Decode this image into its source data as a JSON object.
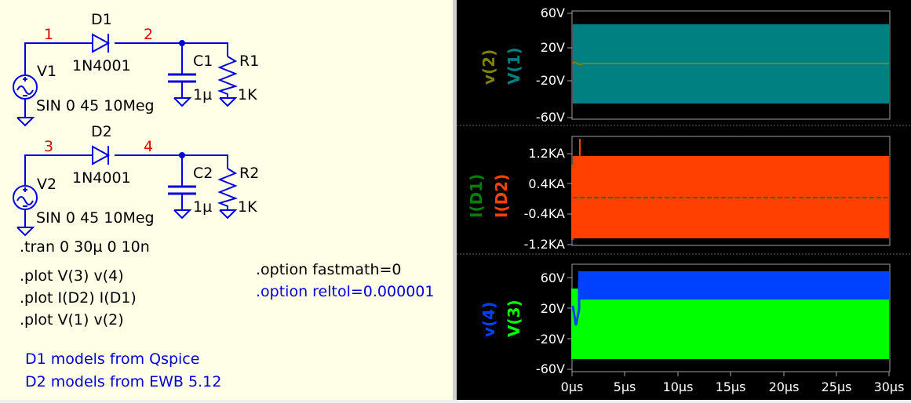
{
  "schematic": {
    "nodes": [
      "1",
      "2",
      "3",
      "4"
    ],
    "diodes": [
      {
        "ref": "D1",
        "model": "1N4001"
      },
      {
        "ref": "D2",
        "model": "1N4001"
      }
    ],
    "sources": [
      {
        "ref": "V1",
        "value": "SIN 0 45 10Meg"
      },
      {
        "ref": "V2",
        "value": "SIN 0 45 10Meg"
      }
    ],
    "capacitors": [
      {
        "ref": "C1",
        "value": "1µ"
      },
      {
        "ref": "C2",
        "value": "1µ"
      }
    ],
    "resistors": [
      {
        "ref": "R1",
        "value": "1K"
      },
      {
        "ref": "R2",
        "value": "1K"
      }
    ],
    "directives": [
      ".tran 0 30µ 0 10n",
      ".plot V(3) v(4)",
      ".plot I(D2) I(D1)",
      ".plot V(1) v(2)"
    ],
    "options": [
      ".option fastmath=0",
      ".option reltol=0.000001"
    ],
    "comments": [
      "D1 models from Qspice",
      "D2 models from EWB 5.12"
    ]
  },
  "waveform_panes": [
    {
      "traces": [
        {
          "name": "v(2)",
          "color": "#808000"
        },
        {
          "name": "V(1)",
          "color": "#008080"
        }
      ],
      "y_ticks": [
        "60V",
        "20V",
        "-20V",
        "-60V"
      ]
    },
    {
      "traces": [
        {
          "name": "I(D1)",
          "color": "#008000"
        },
        {
          "name": "I(D2)",
          "color": "#ff4000"
        }
      ],
      "y_ticks": [
        "1.2KA",
        "0.4KA",
        "-0.4KA",
        "-1.2KA"
      ]
    },
    {
      "traces": [
        {
          "name": "v(4)",
          "color": "#0040ff"
        },
        {
          "name": "V(3)",
          "color": "#00ff00"
        }
      ],
      "y_ticks": [
        "60V",
        "20V",
        "-20V",
        "-60V"
      ]
    }
  ],
  "x_ticks": [
    "0µs",
    "5µs",
    "10µs",
    "15µs",
    "20µs",
    "25µs",
    "30µs"
  ]
}
